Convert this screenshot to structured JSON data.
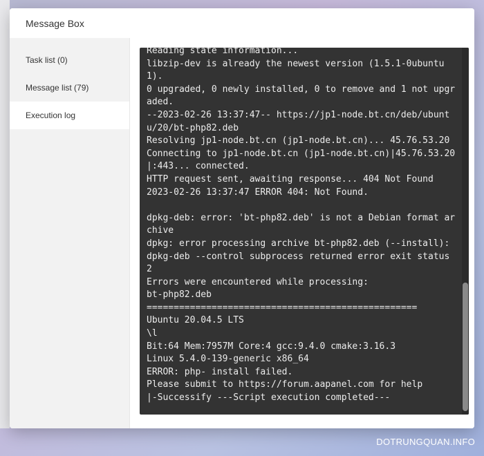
{
  "modal": {
    "title": "Message Box"
  },
  "sidebar": {
    "items": [
      {
        "label": "Task list (0)",
        "active": false
      },
      {
        "label": "Message list (79)",
        "active": false
      },
      {
        "label": "Execution log",
        "active": true
      }
    ]
  },
  "log": {
    "text": "Reading state information...\nlibzip-dev is already the newest version (1.5.1-0ubuntu1).\n0 upgraded, 0 newly installed, 0 to remove and 1 not upgraded.\n--2023-02-26 13:37:47-- https://jp1-node.bt.cn/deb/ubuntu/20/bt-php82.deb\nResolving jp1-node.bt.cn (jp1-node.bt.cn)... 45.76.53.20\nConnecting to jp1-node.bt.cn (jp1-node.bt.cn)|45.76.53.20|:443... connected.\nHTTP request sent, awaiting response... 404 Not Found\n2023-02-26 13:37:47 ERROR 404: Not Found.\n\ndpkg-deb: error: 'bt-php82.deb' is not a Debian format archive\ndpkg: error processing archive bt-php82.deb (--install):\ndpkg-deb --control subprocess returned error exit status 2\nErrors were encountered while processing:\nbt-php82.deb\n==================================================\nUbuntu 20.04.5 LTS\n\\l\nBit:64 Mem:7957M Core:4 gcc:9.4.0 cmake:3.16.3\nLinux 5.4.0-139-generic x86_64\nERROR: php- install failed.\nPlease submit to https://forum.aapanel.com for help\n|-Successify ---Script execution completed---"
  },
  "watermark": "DOTRUNGQUAN.INFO",
  "colors": {
    "log_background": "#333333",
    "log_text": "#ececec",
    "sidebar_background": "#f2f2f2"
  }
}
